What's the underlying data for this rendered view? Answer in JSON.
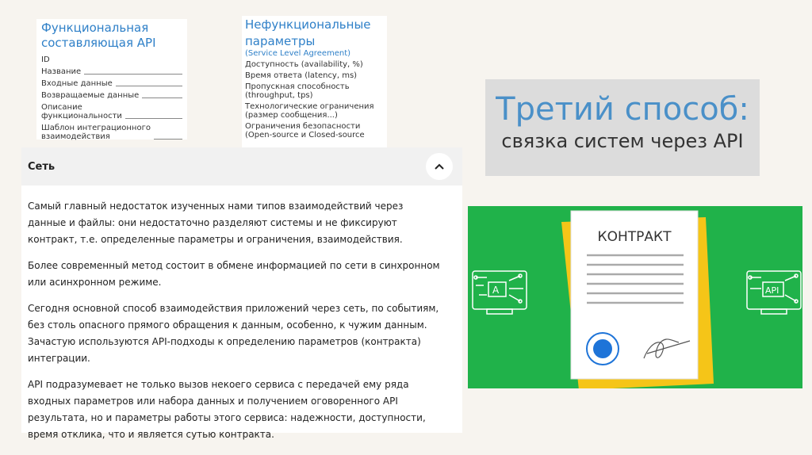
{
  "func_card": {
    "title": "Функциональная составляющая API",
    "rows": [
      "ID",
      "Название",
      "Входные данные",
      "Возвращаемые данные",
      "Описание\nфункциональности",
      "Шаблон интеграционного\nвзаимодействия"
    ]
  },
  "nonfunc_card": {
    "title1": "Нефункциональные",
    "title2": "параметры",
    "subtitle": "(Service Level Agreement)",
    "items": [
      [
        "Доступность (availability, %)"
      ],
      [
        "Время ответа (latency, ms)"
      ],
      [
        "Пропускная способность",
        "(throughput, tps)"
      ],
      [
        "Технологические ограничения",
        "(размер сообщения...)"
      ],
      [
        "Ограничения безопасности",
        "(Open-source и Closed-source"
      ]
    ]
  },
  "network": {
    "title": "Сеть",
    "paragraphs": [
      "Самый главный недостаток изученных нами типов взаимодействий через данные и файлы: они недостаточно разделяют системы и не фиксируют контракт, т.е. определенные параметры и ограничения, взаимодействия.",
      "Более современный метод состоит в обмене информацией по сети в синхронном или асинхронном режиме.",
      "Сегодня основной способ взаимодействия приложений через сеть, по событиям, без столь опасного прямого обращения к данным, особенно, к чужим данным. Зачастую используются API-подходы к определению параметров (контракта) интеграции.",
      "API подразумевает не только вызов некоего сервиса с передачей ему ряда входных параметров или набора данных и получением оговоренного API результата, но и параметры работы этого сервиса: надежности, доступности, время отклика, что и является сутью контракта."
    ]
  },
  "title_box": {
    "line1": "Третий способ:",
    "line2": "связка систем через API"
  },
  "illustration": {
    "contract_label": "КОНТРАКТ",
    "left_monitor_text": "A",
    "right_monitor_text": "API",
    "colors": {
      "background": "#20b24a",
      "paper": "#ffffff",
      "folder": "#f5c518",
      "seal": "#1e74d8"
    }
  }
}
